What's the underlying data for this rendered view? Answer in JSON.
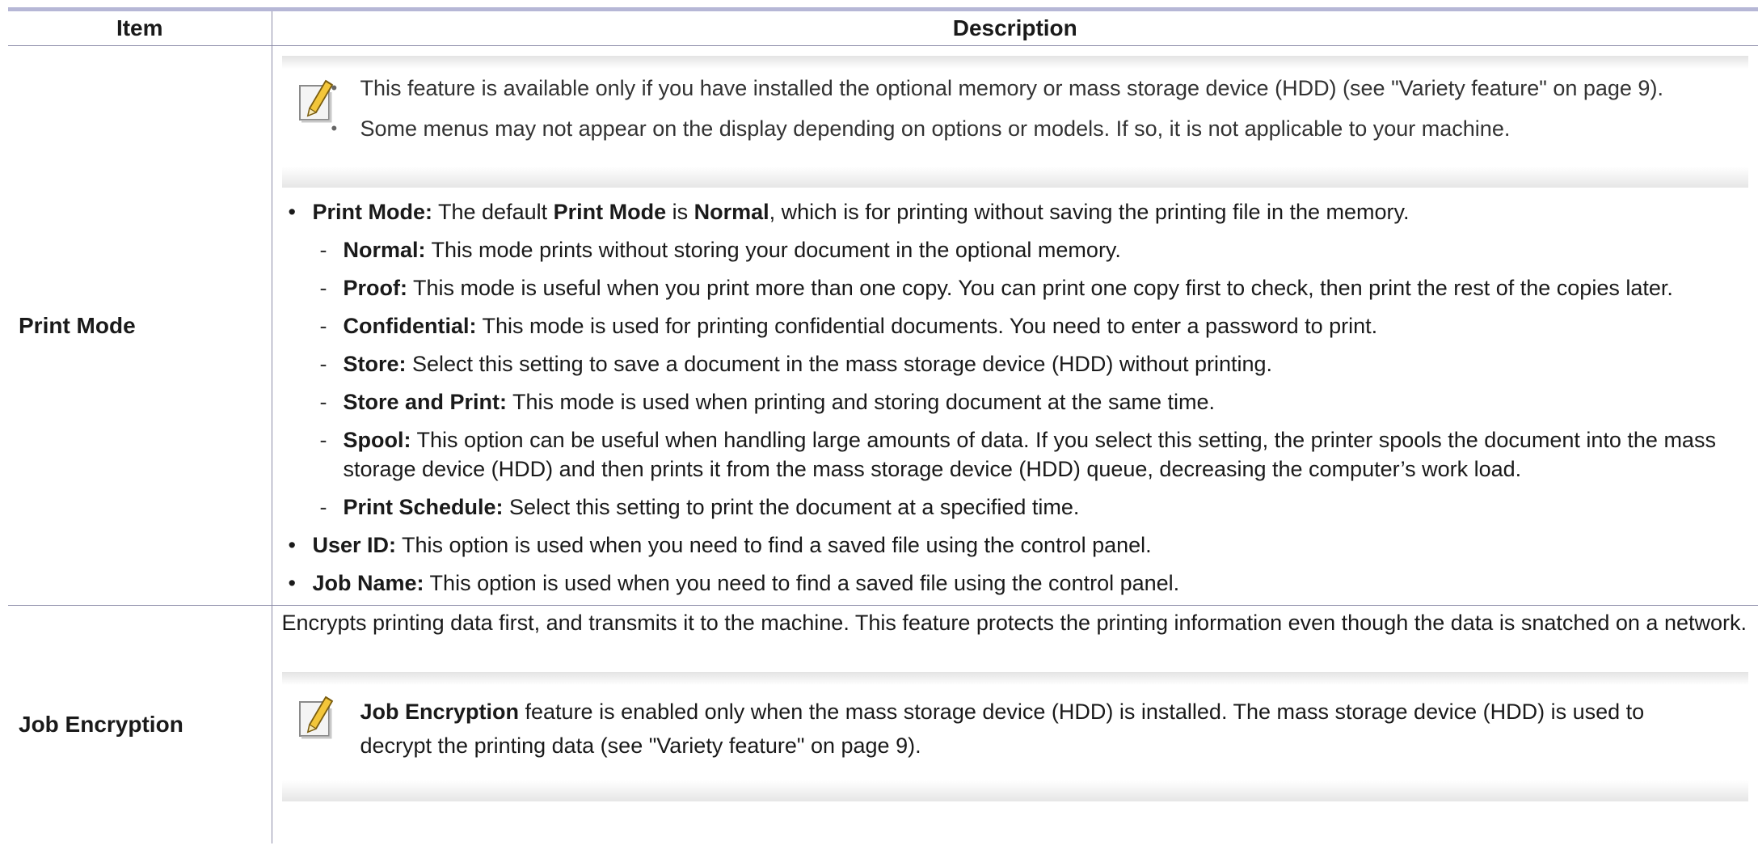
{
  "table": {
    "header": {
      "item": "Item",
      "description": "Description"
    },
    "rows": [
      {
        "item": "Print Mode",
        "notes": [
          "This feature is available only if you have installed the optional memory or mass storage device (HDD) (see \"Variety feature\" on page 9).",
          "Some menus may not appear on the display depending on options or models. If so, it is not applicable to your machine."
        ],
        "bullets": [
          {
            "parts": [
              {
                "bold": "Print Mode:"
              },
              {
                "text": " The default "
              },
              {
                "bold": "Print Mode"
              },
              {
                "text": " is "
              },
              {
                "bold": "Normal"
              },
              {
                "text": ", which is for printing without saving the printing file in the memory."
              }
            ],
            "sub": [
              {
                "term": "Normal:",
                "text": " This mode prints without storing your document in the optional memory."
              },
              {
                "term": "Proof:",
                "text": " This mode is useful when you print more than one copy. You can print one copy first to check, then print the rest of the copies later."
              },
              {
                "term": "Confidential:",
                "text": " This mode is used for printing confidential documents. You need to enter a password to print."
              },
              {
                "term": "Store:",
                "text": " Select this setting to save a document in the mass storage device (HDD) without printing."
              },
              {
                "term": "Store and Print:",
                "text": " This mode is used when printing and storing document at the same time."
              },
              {
                "term": "Spool:",
                "text": " This option can be useful when handling large amounts of data. If you select this setting, the printer spools the document into the mass storage device (HDD) and then prints it from the mass storage device (HDD) queue, decreasing the computer’s work load."
              },
              {
                "term": "Print Schedule:",
                "text": " Select this setting to print the document at a specified time."
              }
            ]
          },
          {
            "parts": [
              {
                "bold": "User ID:"
              },
              {
                "text": " This option is used when you need to find a saved file using the control panel."
              }
            ],
            "sub": []
          },
          {
            "parts": [
              {
                "bold": "Job Name:"
              },
              {
                "text": " This option is used when you need to find a saved file using the control panel."
              }
            ],
            "sub": []
          }
        ]
      },
      {
        "item": "Job Encryption",
        "intro": "Encrypts printing data first, and transmits it to the machine. This feature protects the printing information even though the data is snatched on a network.",
        "note": {
          "bold": "Job Encryption",
          "text": " feature is enabled only when the mass storage device (HDD) is installed. The mass storage device (HDD) is used to decrypt the printing data (see \"Variety feature\" on page 9)."
        }
      }
    ]
  },
  "icons": {
    "note": "note-pencil-icon"
  },
  "colors": {
    "rule": "#b6b7d6",
    "border": "#8b8ba8"
  }
}
